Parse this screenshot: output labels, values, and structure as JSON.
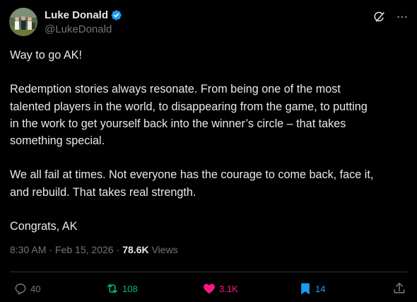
{
  "author": {
    "display_name": "Luke Donald",
    "handle": "@LukeDonald",
    "verified": true
  },
  "tweet": {
    "paragraphs": [
      [
        "Way to go AK!"
      ],
      [
        "Redemption stories always resonate. From being one of the most",
        "talented players in the world, to disappearing from the game, to putting",
        "in the work to get yourself back into the winner’s circle – that takes",
        "something special."
      ],
      [
        "We all fail at times. Not everyone has the courage to come back, face it,",
        "and rebuild. That takes real strength."
      ],
      [
        "Congrats, AK"
      ]
    ]
  },
  "meta": {
    "time": "8:30 AM",
    "date": "Feb 15, 2026",
    "views_count": "78.6K",
    "views_label": "Views"
  },
  "actions": {
    "replies": "40",
    "reposts": "108",
    "likes": "3.1K",
    "bookmarks": "14"
  },
  "colors": {
    "background": "#000000",
    "text": "#e7e9ea",
    "muted": "#71767b",
    "verified": "#1d9bf0",
    "repost_active": "#00ba7c",
    "like_active": "#f91880",
    "bookmark_active": "#1d9bf0"
  },
  "icons": [
    "verified-badge-icon",
    "grok-icon",
    "more-icon",
    "reply-icon",
    "repost-icon",
    "like-icon",
    "bookmark-icon",
    "share-icon"
  ]
}
